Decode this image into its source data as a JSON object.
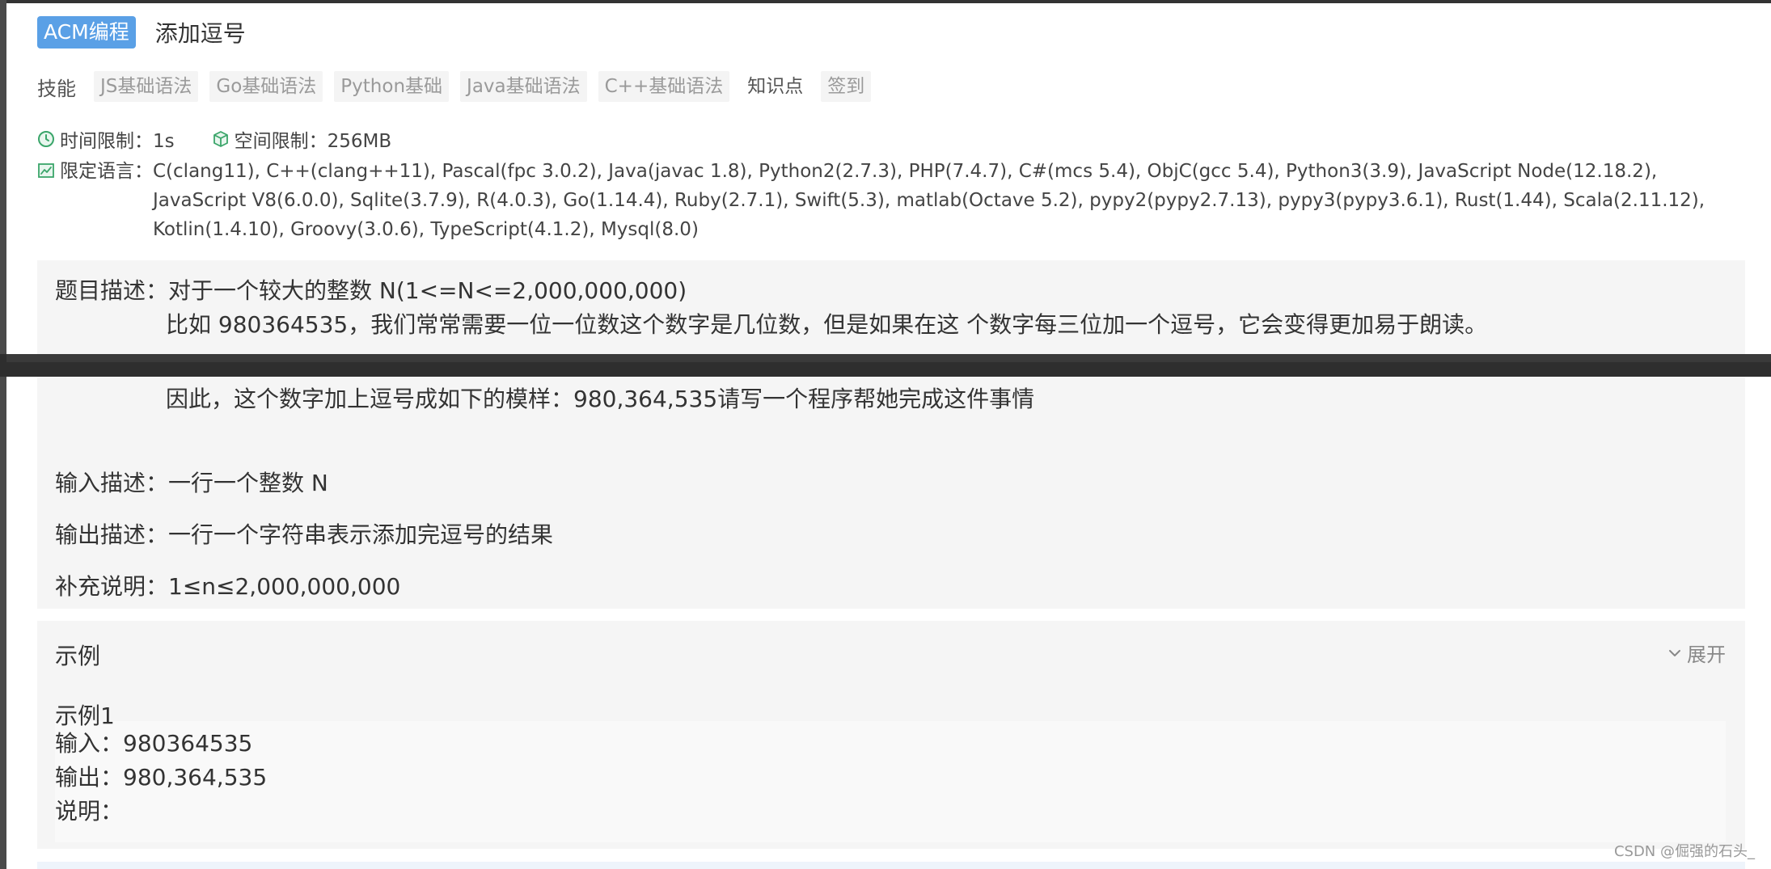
{
  "header": {
    "badge": "ACM编程",
    "title": "添加逗号"
  },
  "skills": {
    "label": "技能",
    "tags": [
      "JS基础语法",
      "Go基础语法",
      "Python基础",
      "Java基础语法",
      "C++基础语法"
    ],
    "knowledge": "知识点",
    "signin": "签到"
  },
  "limits": {
    "time": "时间限制：1s",
    "space": "空间限制：256MB",
    "lang_label": "限定语言：",
    "languages": "C(clang11), C++(clang++11), Pascal(fpc 3.0.2), Java(javac 1.8), Python2(2.7.3), PHP(7.4.7), C#(mcs 5.4), ObjC(gcc 5.4), Python3(3.9), JavaScript Node(12.18.2), JavaScript V8(6.0.0), Sqlite(3.7.9), R(4.0.3), Go(1.14.4), Ruby(2.7.1), Swift(5.3), matlab(Octave 5.2), pypy2(pypy2.7.13), pypy3(pypy3.6.1), Rust(1.44), Scala(2.11.12), Kotlin(1.4.10), Groovy(3.0.6), TypeScript(4.1.2), Mysql(8.0)"
  },
  "description": {
    "line1": "题目描述：对于一个较大的整数 N(1<=N<=2,000,000,000)",
    "line2": "比如 980364535，我们常常需要一位一位数这个数字是几位数，但是如果在这 个数字每三位加一个逗号，它会变得更加易于朗读。",
    "line3": "因此，这个数字加上逗号成如下的模样：980,364,535请写一个程序帮她完成这件事情",
    "input": "输入描述：一行一个整数 N",
    "output": "输出描述：一行一个字符串表示添加完逗号的结果",
    "note": "补充说明：1≤n≤2,000,000,000"
  },
  "example": {
    "title": "示例",
    "expand_label": "展开",
    "case_title": "示例1",
    "input": "输入：980364535",
    "output": "输出：980,364,535",
    "explain": "说明："
  },
  "watermark": "CSDN @倔强的石头_",
  "colors": {
    "badge": "#5aa0e6",
    "panel": "#f5f5f5",
    "divider": "#2e2e2e"
  }
}
